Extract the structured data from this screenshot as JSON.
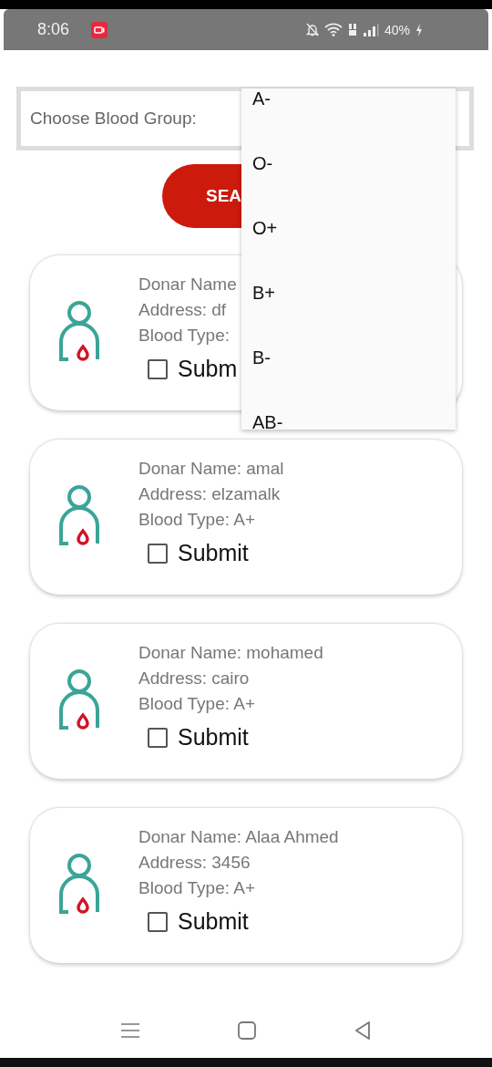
{
  "status_bar": {
    "time": "8:06",
    "battery": "40%"
  },
  "blood_group_select": {
    "label": "Choose Blood Group:",
    "expanded": true,
    "options": [
      {
        "label": "A-"
      },
      {
        "label": "O-"
      },
      {
        "label": "O+"
      },
      {
        "label": "B+"
      },
      {
        "label": "B-"
      },
      {
        "label": "AB-"
      }
    ]
  },
  "search_button": {
    "label": "SEA"
  },
  "donors": [
    {
      "name_line": "Donar Name",
      "address_line": "Address: df",
      "blood_type_line": "Blood Type:",
      "submit_label": "Subm",
      "checked": false
    },
    {
      "name_line": "Donar Name: amal",
      "address_line": "Address: elzamalk",
      "blood_type_line": "Blood Type: A+",
      "submit_label": "Submit",
      "checked": false
    },
    {
      "name_line": "Donar Name: mohamed",
      "address_line": "Address: cairo",
      "blood_type_line": "Blood Type: A+",
      "submit_label": "Submit",
      "checked": false
    },
    {
      "name_line": "Donar Name: Alaa Ahmed",
      "address_line": "Address: 3456",
      "blood_type_line": "Blood Type: A+",
      "submit_label": "Submit",
      "checked": false
    }
  ]
}
